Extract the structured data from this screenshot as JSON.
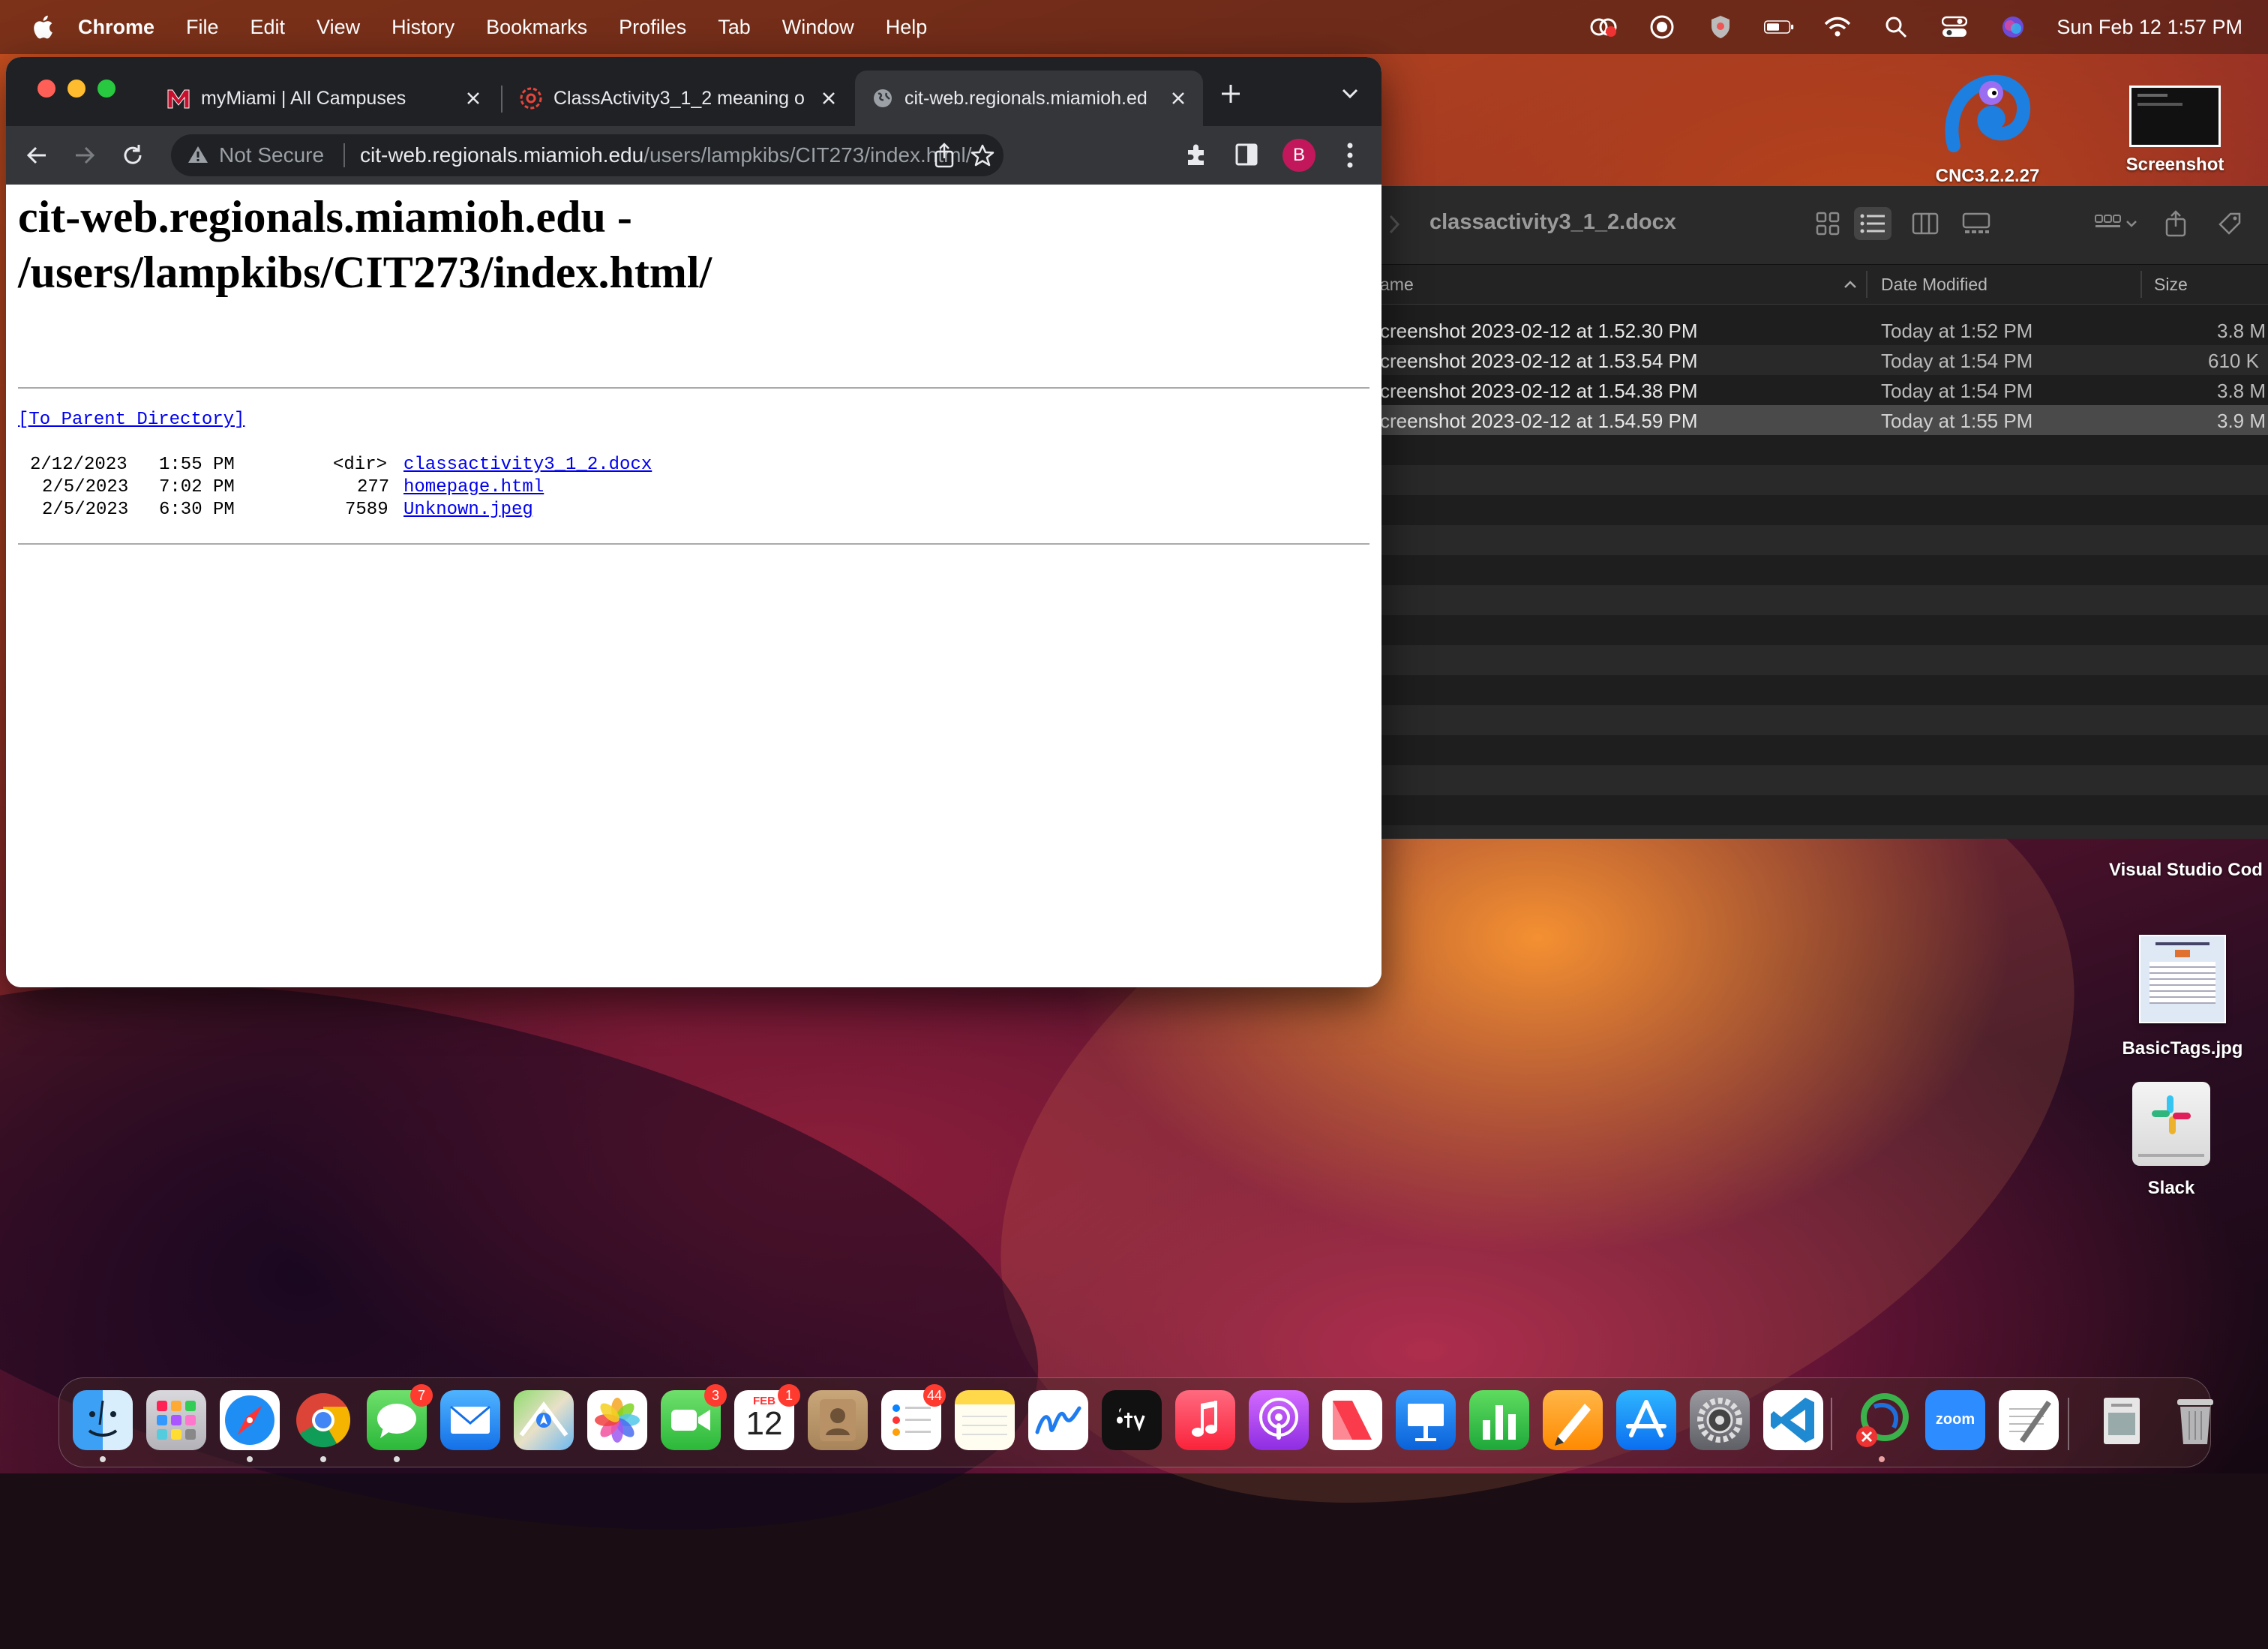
{
  "menubar": {
    "app": "Chrome",
    "items": [
      "File",
      "Edit",
      "View",
      "History",
      "Bookmarks",
      "Profiles",
      "Tab",
      "Window",
      "Help"
    ],
    "clock": "Sun Feb 12  1:57 PM"
  },
  "tabs": [
    {
      "label": "myMiami | All Campuses"
    },
    {
      "label": "ClassActivity3_1_2 meaning o"
    },
    {
      "label": "cit-web.regionals.miamioh.ed"
    }
  ],
  "address": {
    "security": "Not Secure",
    "domain": "cit-web.regionals.miamioh.edu",
    "path": "/users/lampkibs/CIT273/index.html/"
  },
  "profile_initial": "B",
  "page": {
    "heading_line1": "cit-web.regionals.miamioh.edu -",
    "heading_line2": "/users/lampkibs/CIT273/index.html/",
    "parent_link": "[To Parent Directory]",
    "entries": [
      {
        "date": "2/12/2023",
        "time": "1:55 PM",
        "size": "<dir>",
        "name": "classactivity3_1_2.docx"
      },
      {
        "date": "2/5/2023",
        "time": "7:02 PM",
        "size": "277",
        "name": "homepage.html"
      },
      {
        "date": "2/5/2023",
        "time": "6:30 PM",
        "size": "7589",
        "name": "Unknown.jpeg"
      }
    ]
  },
  "finder": {
    "title": "classactivity3_1_2.docx",
    "columns": {
      "name": "ame",
      "date": "Date Modified",
      "size": "Size"
    },
    "rows": [
      {
        "name": "creenshot 2023-02-12 at 1.52.30 PM",
        "date": "Today at 1:52 PM",
        "size": "3.8 M"
      },
      {
        "name": "creenshot 2023-02-12 at 1.53.54 PM",
        "date": "Today at 1:54 PM",
        "size": "610 K"
      },
      {
        "name": "creenshot 2023-02-12 at 1.54.38 PM",
        "date": "Today at 1:54 PM",
        "size": "3.8 M"
      },
      {
        "name": "creenshot 2023-02-12 at 1.54.59 PM",
        "date": "Today at 1:55 PM",
        "size": "3.9 M"
      }
    ]
  },
  "desktop": {
    "cnc_label": "CNC3.2.2.27",
    "screenshot_label": "Screenshot",
    "vscode_label": "Visual Studio Cod",
    "basictags_label": "BasicTags.jpg",
    "slack_label": "Slack"
  },
  "dock": {
    "badges": {
      "messages": "7",
      "facetime": "3",
      "calendar": "1",
      "reminders": "44"
    },
    "calendar_month": "FEB",
    "calendar_day": "12",
    "zoom_label": "zoom"
  },
  "colors": {
    "link": "#0000ee",
    "accent_avatar": "#c2185b"
  }
}
